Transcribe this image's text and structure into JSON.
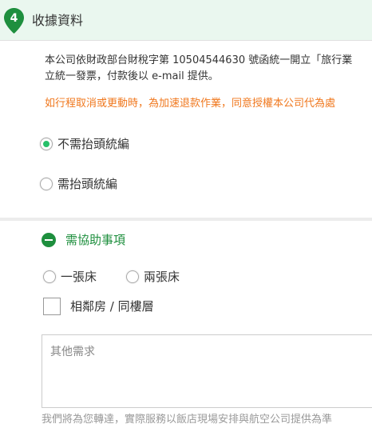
{
  "header": {
    "step_number": "4",
    "title": "收據資料"
  },
  "notice": {
    "line1": "本公司依財政部台財稅字第 10504544630 號函統一開立「旅行業",
    "line2": "立統一發票，付款後以 e-mail 提供。"
  },
  "warning": "如行程取消或更動時，為加速退款作業，同意授權本公司代為處",
  "invoice_options": [
    {
      "label": "不需抬頭統編",
      "checked": true
    },
    {
      "label": "需抬頭統編",
      "checked": false
    }
  ],
  "assistance": {
    "title": "需協助事項",
    "bed_options": [
      {
        "label": "一張床",
        "checked": false
      },
      {
        "label": "兩張床",
        "checked": false
      }
    ],
    "adjacent_room_label": "相鄰房 / 同樓層",
    "other_placeholder": "其他需求",
    "footnote": "我們將為您轉達，實際服務以飯店現場安排與航空公司提供為準"
  },
  "colors": {
    "accent_green": "#27c06a",
    "dark_green": "#1e8f3e",
    "warning_orange": "#f0781e"
  }
}
